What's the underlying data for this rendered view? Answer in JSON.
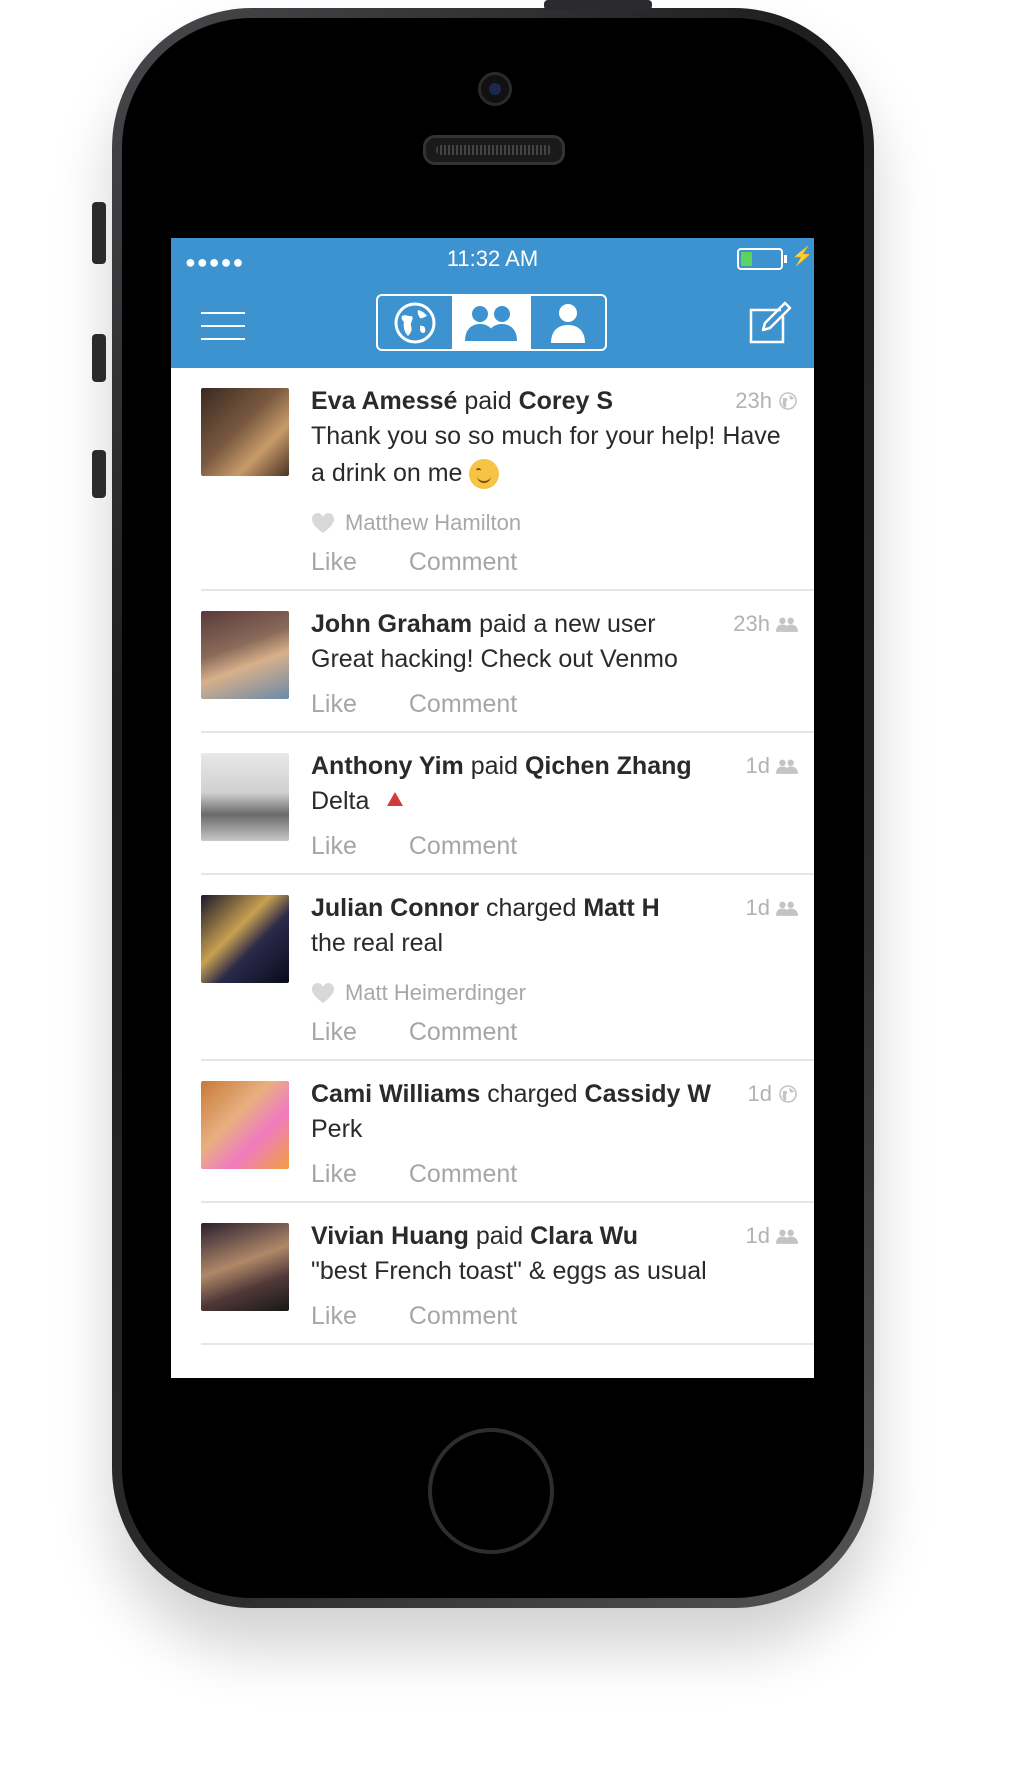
{
  "status_bar": {
    "signal": "●●●●●",
    "time": "11:32 AM",
    "battery_level": 0.3
  },
  "nav": {
    "segments": [
      {
        "name": "globe-icon",
        "label": "Public"
      },
      {
        "name": "friends-icon",
        "label": "Friends"
      },
      {
        "name": "person-icon",
        "label": "You"
      }
    ],
    "selected_segment": 1
  },
  "feed": [
    {
      "actor": "Eva Amessé",
      "verb": "paid",
      "target": "Corey S",
      "time": "23h",
      "audience_icon": "globe-icon",
      "message": "Thank you so so much for your help! Have a drink on me",
      "has_emoji": true,
      "liker": "Matthew Hamilton",
      "like": "Like",
      "comment": "Comment"
    },
    {
      "actor": "John Graham",
      "verb": "paid",
      "target_plain": "a new user",
      "time": "23h",
      "audience_icon": "friends-icon",
      "message": "Great hacking! Check out Venmo",
      "like": "Like",
      "comment": "Comment"
    },
    {
      "actor": "Anthony Yim",
      "verb": "paid",
      "target": "Qichen Zhang",
      "time": "1d",
      "audience_icon": "friends-icon",
      "message": "Delta",
      "has_warn": true,
      "like": "Like",
      "comment": "Comment"
    },
    {
      "actor": "Julian Connor",
      "verb": "charged",
      "target": "Matt H",
      "time": "1d",
      "audience_icon": "friends-icon",
      "message": "the real real",
      "liker": "Matt Heimerdinger",
      "like": "Like",
      "comment": "Comment"
    },
    {
      "actor": "Cami Williams",
      "verb": "charged",
      "target": "Cassidy W",
      "time": "1d",
      "audience_icon": "globe-icon",
      "message": "Perk",
      "like": "Like",
      "comment": "Comment"
    },
    {
      "actor": "Vivian Huang",
      "verb": "paid",
      "target": "Clara Wu",
      "time": "1d",
      "audience_icon": "friends-icon",
      "message": "\"best French toast\" & eggs as usual",
      "like": "Like",
      "comment": "Comment"
    }
  ],
  "colors": {
    "accent": "#3d93d0",
    "battery": "#5ad45a",
    "warning": "#d23b3b"
  }
}
